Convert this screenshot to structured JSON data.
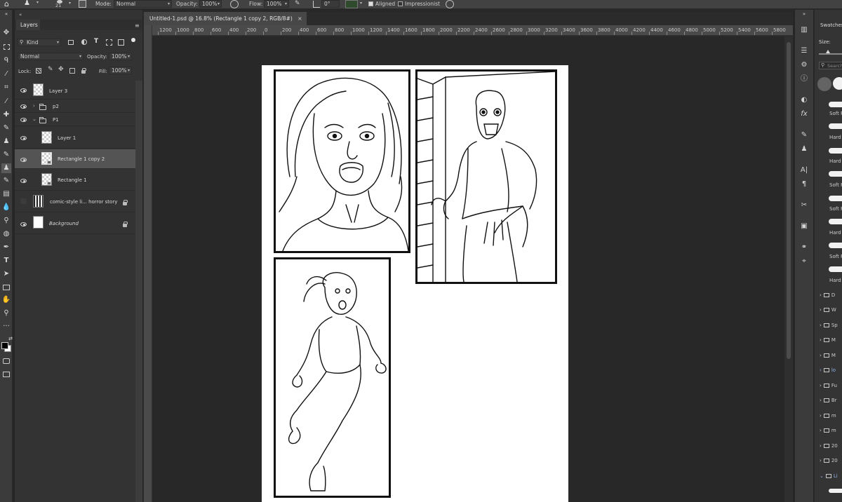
{
  "options_bar": {
    "brush_size": "21",
    "mode_label": "Mode:",
    "mode_value": "Normal",
    "opacity_label": "Opacity:",
    "opacity_value": "100%",
    "flow_label": "Flow:",
    "flow_value": "100%",
    "angle_value": "0°",
    "aligned_label": "Aligned",
    "aligned_checked": true,
    "impressionist_label": "Impressionist",
    "impressionist_checked": false
  },
  "layers_panel": {
    "tab_label": "Layers",
    "filter_kind": "Kind",
    "blend_mode": "Normal",
    "opacity_label": "Opacity:",
    "opacity_value": "100%",
    "lock_label": "Lock:",
    "fill_label": "Fill:",
    "fill_value": "100%",
    "layers": [
      {
        "name": "Layer 3",
        "visible": true,
        "type": "layer"
      },
      {
        "name": "p2",
        "visible": true,
        "type": "group-collapsed"
      },
      {
        "name": "P1",
        "visible": true,
        "type": "group-expanded"
      },
      {
        "name": "Layer 1",
        "visible": true,
        "type": "layer"
      },
      {
        "name": "Rectangle 1 copy 2",
        "visible": true,
        "type": "layer",
        "selected": true
      },
      {
        "name": "Rectangle 1",
        "visible": true,
        "type": "layer"
      },
      {
        "name": "comic-style li... horror story",
        "visible": false,
        "type": "locked"
      },
      {
        "name": "Background",
        "visible": true,
        "type": "background"
      }
    ]
  },
  "document": {
    "tab_title": "Untitled-1.psd @ 16.8% (Rectangle 1 copy 2, RGB/8#)",
    "close_glyph": "×",
    "ruler_labels": [
      "1200",
      "1000",
      "800",
      "600",
      "400",
      "200",
      "0",
      "200",
      "400",
      "600",
      "800",
      "1000",
      "1200",
      "1400",
      "1600",
      "1800",
      "2000",
      "2200",
      "2400",
      "2600",
      "2800",
      "3000",
      "3200",
      "3400",
      "3600",
      "3800",
      "4000",
      "4200",
      "4400",
      "4600",
      "4800",
      "5000",
      "5200",
      "5400",
      "5600",
      "5800"
    ]
  },
  "right_panel": {
    "tab_label": "Swatches",
    "size_label": "Size:",
    "search_placeholder": "Search",
    "brushes": [
      "Soft R",
      "Hard",
      "Hard",
      "Soft R",
      "Soft R",
      "Hard",
      "Soft R",
      "Hard"
    ],
    "folders": [
      "D",
      "W",
      "Sp",
      "M",
      "M",
      "lo",
      "Fu",
      "Br",
      "m",
      "m",
      "20",
      "20",
      "Li"
    ]
  },
  "artwork": {
    "panel_1_description_visible": false
  }
}
